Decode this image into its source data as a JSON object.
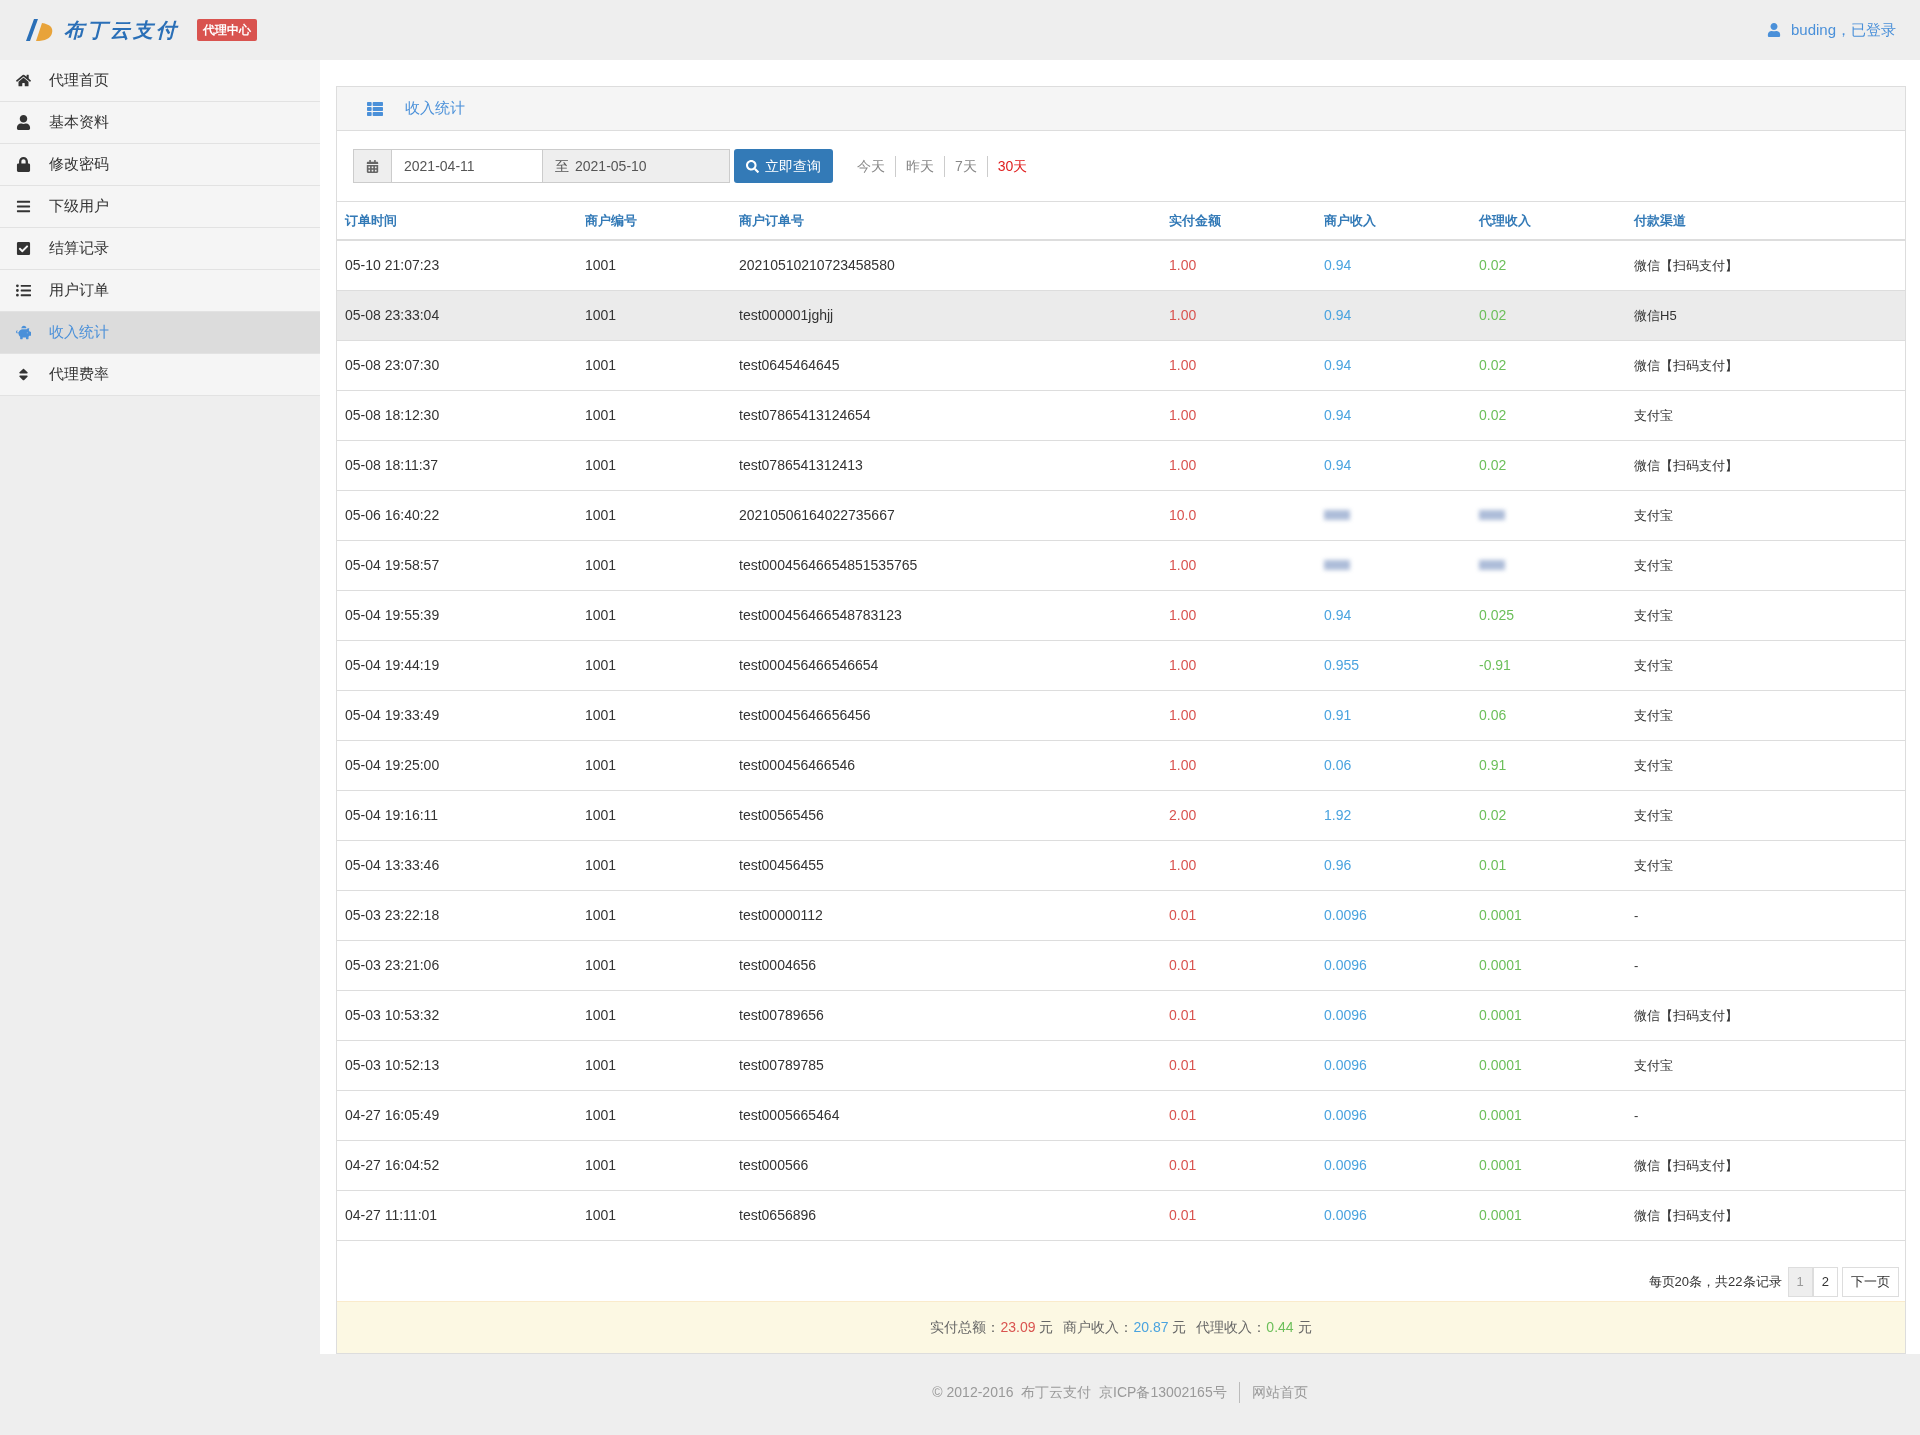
{
  "header": {
    "logo_text": "布丁云支付",
    "badge": "代理中心",
    "user": "buding，已登录"
  },
  "sidebar": {
    "items": [
      {
        "label": "代理首页",
        "selected": false
      },
      {
        "label": "基本资料",
        "selected": false
      },
      {
        "label": "修改密码",
        "selected": false
      },
      {
        "label": "下级用户",
        "selected": false
      },
      {
        "label": "结算记录",
        "selected": false
      },
      {
        "label": "用户订单",
        "selected": false
      },
      {
        "label": "收入统计",
        "selected": true
      },
      {
        "label": "代理费率",
        "selected": false
      }
    ]
  },
  "panel": {
    "title": "收入统计"
  },
  "filter": {
    "start": "2021-04-11",
    "separator": "至",
    "end": "2021-05-10",
    "search_button": "立即查询",
    "quick": [
      {
        "label": "今天",
        "selected": false
      },
      {
        "label": "昨天",
        "selected": false
      },
      {
        "label": "7天",
        "selected": false
      },
      {
        "label": "30天",
        "selected": true
      }
    ]
  },
  "table": {
    "columns": [
      "订单时间",
      "商户编号",
      "商户订单号",
      "实付金额",
      "商户收入",
      "代理收入",
      "付款渠道"
    ],
    "rows": [
      {
        "time": "05-10 21:07:23",
        "merchant": "1001",
        "order": "20210510210723458580",
        "amount": "1.00",
        "merchant_income": "0.94",
        "agent_income": "0.02",
        "channel": "微信【扫码支付】",
        "selected": false
      },
      {
        "time": "05-08 23:33:04",
        "merchant": "1001",
        "order": "test000001jghjj",
        "amount": "1.00",
        "merchant_income": "0.94",
        "agent_income": "0.02",
        "channel": "微信H5",
        "selected": true
      },
      {
        "time": "05-08 23:07:30",
        "merchant": "1001",
        "order": "test0645464645",
        "amount": "1.00",
        "merchant_income": "0.94",
        "agent_income": "0.02",
        "channel": "微信【扫码支付】",
        "selected": false
      },
      {
        "time": "05-08 18:12:30",
        "merchant": "1001",
        "order": "test07865413124654",
        "amount": "1.00",
        "merchant_income": "0.94",
        "agent_income": "0.02",
        "channel": "支付宝",
        "selected": false
      },
      {
        "time": "05-08 18:11:37",
        "merchant": "1001",
        "order": "test0786541312413",
        "amount": "1.00",
        "merchant_income": "0.94",
        "agent_income": "0.02",
        "channel": "微信【扫码支付】",
        "selected": false
      },
      {
        "time": "05-06 16:40:22",
        "merchant": "1001",
        "order": "20210506164022735667",
        "amount": "10.0",
        "channel": "支付宝",
        "selected": false
      },
      {
        "time": "05-04 19:58:57",
        "merchant": "1001",
        "order": "test00045646654851535765",
        "amount": "1.00",
        "channel": "支付宝",
        "selected": false
      },
      {
        "time": "05-04 19:55:39",
        "merchant": "1001",
        "order": "test000456466548783123",
        "amount": "1.00",
        "merchant_income": "0.94",
        "agent_income": "0.025",
        "channel": "支付宝",
        "selected": false
      },
      {
        "time": "05-04 19:44:19",
        "merchant": "1001",
        "order": "test000456466546654",
        "amount": "1.00",
        "merchant_income": "0.955",
        "agent_income": "-0.91",
        "channel": "支付宝",
        "selected": false
      },
      {
        "time": "05-04 19:33:49",
        "merchant": "1001",
        "order": "test00045646656456",
        "amount": "1.00",
        "merchant_income": "0.91",
        "agent_income": "0.06",
        "channel": "支付宝",
        "selected": false
      },
      {
        "time": "05-04 19:25:00",
        "merchant": "1001",
        "order": "test000456466546",
        "amount": "1.00",
        "merchant_income": "0.06",
        "agent_income": "0.91",
        "channel": "支付宝",
        "selected": false
      },
      {
        "time": "05-04 19:16:11",
        "merchant": "1001",
        "order": "test00565456",
        "amount": "2.00",
        "merchant_income": "1.92",
        "agent_income": "0.02",
        "channel": "支付宝",
        "selected": false
      },
      {
        "time": "05-04 13:33:46",
        "merchant": "1001",
        "order": "test00456455",
        "amount": "1.00",
        "merchant_income": "0.96",
        "agent_income": "0.01",
        "channel": "支付宝",
        "selected": false
      },
      {
        "time": "05-03 23:22:18",
        "merchant": "1001",
        "order": "test00000112",
        "amount": "0.01",
        "merchant_income": "0.0096",
        "agent_income": "0.0001",
        "channel": "-",
        "selected": false
      },
      {
        "time": "05-03 23:21:06",
        "merchant": "1001",
        "order": "test0004656",
        "amount": "0.01",
        "merchant_income": "0.0096",
        "agent_income": "0.0001",
        "channel": "-",
        "selected": false
      },
      {
        "time": "05-03 10:53:32",
        "merchant": "1001",
        "order": "test00789656",
        "amount": "0.01",
        "merchant_income": "0.0096",
        "agent_income": "0.0001",
        "channel": "微信【扫码支付】",
        "selected": false
      },
      {
        "time": "05-03 10:52:13",
        "merchant": "1001",
        "order": "test00789785",
        "amount": "0.01",
        "merchant_income": "0.0096",
        "agent_income": "0.0001",
        "channel": "支付宝",
        "selected": false
      },
      {
        "time": "04-27 16:05:49",
        "merchant": "1001",
        "order": "test0005665464",
        "amount": "0.01",
        "merchant_income": "0.0096",
        "agent_income": "0.0001",
        "channel": "-",
        "selected": false
      },
      {
        "time": "04-27 16:04:52",
        "merchant": "1001",
        "order": "test000566",
        "amount": "0.01",
        "merchant_income": "0.0096",
        "agent_income": "0.0001",
        "channel": "微信【扫码支付】",
        "selected": false
      },
      {
        "time": "04-27 11:11:01",
        "merchant": "1001",
        "order": "test0656896",
        "amount": "0.01",
        "merchant_income": "0.0096",
        "agent_income": "0.0001",
        "channel": "微信【扫码支付】",
        "selected": false
      }
    ]
  },
  "pagination": {
    "summary": "每页20条，共22条记录",
    "pages": [
      {
        "label": "1",
        "selected": true
      },
      {
        "label": "2",
        "selected": false
      }
    ],
    "next": "下一页"
  },
  "totals": [
    {
      "label": "实付总额：",
      "value": "23.09",
      "unit": "元",
      "kind": "amount"
    },
    {
      "label": "商户收入：",
      "value": "20.87",
      "unit": "元",
      "kind": "merchant"
    },
    {
      "label": "代理收入：",
      "value": "0.44",
      "unit": "元",
      "kind": "agent"
    }
  ],
  "footer": {
    "copyright": "© 2012-2016  布丁云支付  京ICP备13002165号",
    "link": "网站首页"
  }
}
